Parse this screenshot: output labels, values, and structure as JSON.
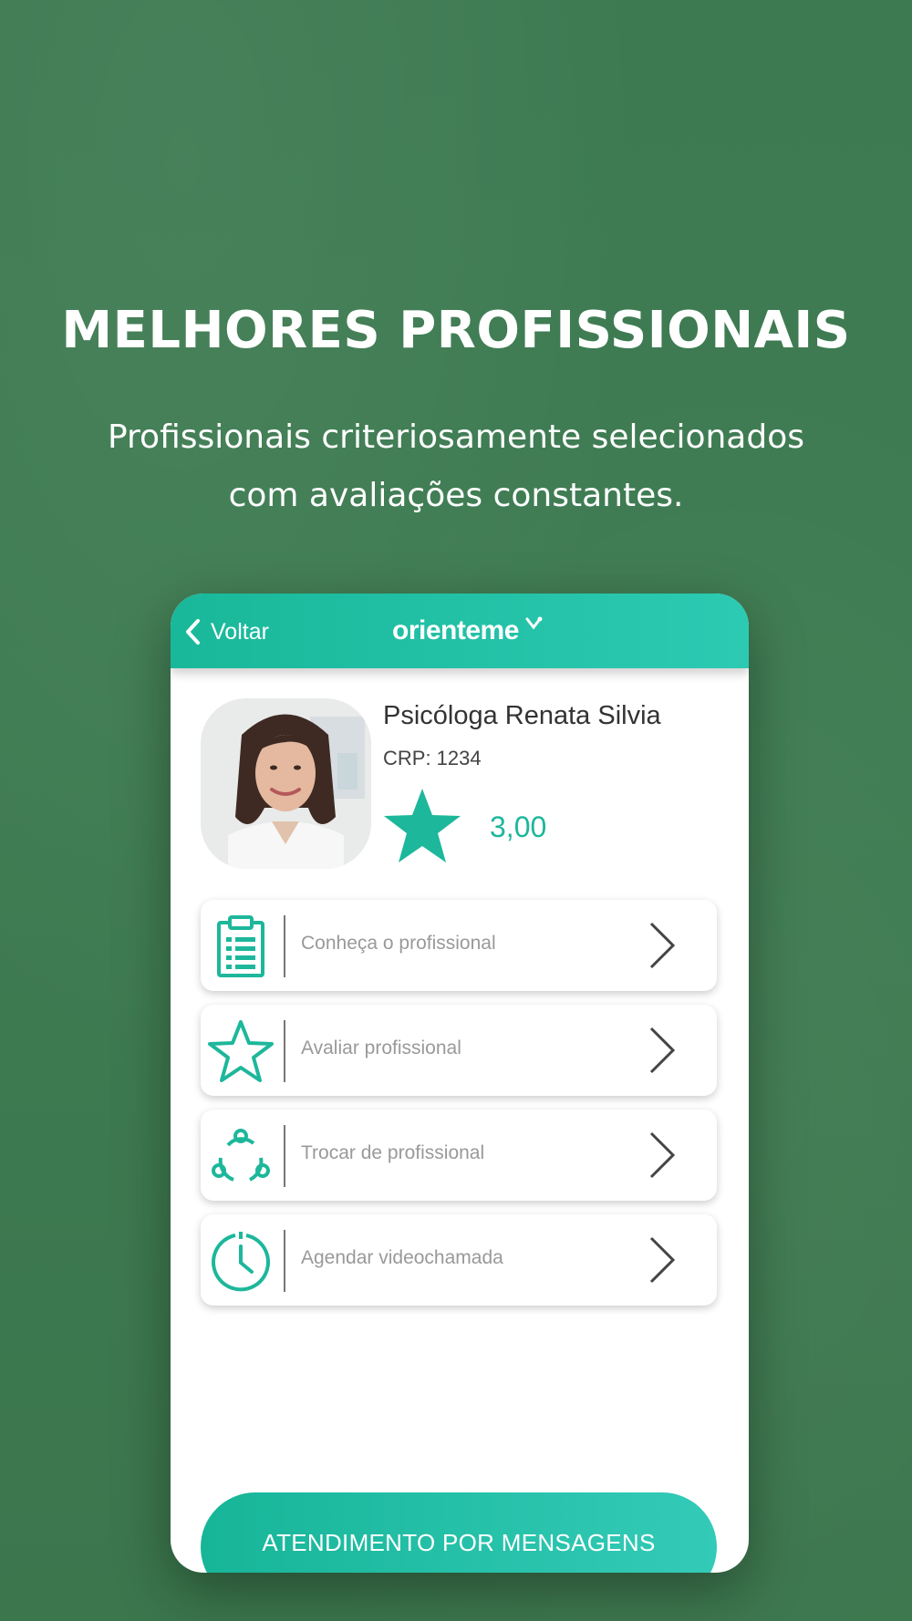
{
  "promo": {
    "headline": "MELHORES PROFISSIONAIS",
    "subline_1": "Profissionais criteriosamente selecionados",
    "subline_2": "com avaliações constantes."
  },
  "app": {
    "back_label": "Voltar",
    "brand": "orienteme",
    "accent_color": "#1db79b",
    "professional": {
      "name": "Psicóloga Renata Silvia",
      "crp": "CRP: 1234",
      "rating": "3,00",
      "rating_icon": "star-icon"
    },
    "menu": [
      {
        "label": "Conheça o profissional",
        "icon": "clipboard-list-icon"
      },
      {
        "label": "Avaliar profissional",
        "icon": "star-outline-icon"
      },
      {
        "label": "Trocar de profissional",
        "icon": "swap-cycle-icon"
      },
      {
        "label": "Agendar videochamada",
        "icon": "clock-icon"
      }
    ],
    "cta_label": "ATENDIMENTO POR MENSAGENS"
  }
}
